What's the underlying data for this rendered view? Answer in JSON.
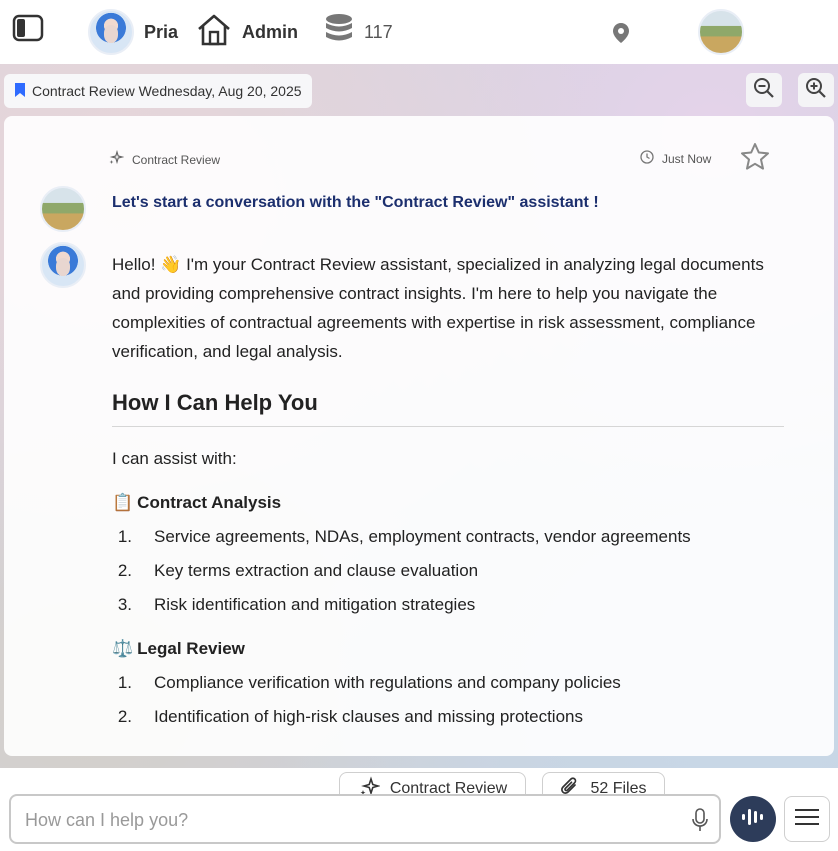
{
  "header": {
    "user_name": "Pria",
    "admin_label": "Admin",
    "credit_count": "117"
  },
  "chat": {
    "title_chip": "Contract Review Wednesday, Aug 20, 2025",
    "assistant_tag": "Contract Review",
    "time_tag": "Just Now",
    "intro": "Let's start a conversation with the \"Contract Review\" assistant !",
    "greeting": "Hello! 👋 I'm your Contract Review assistant, specialized in analyzing legal documents and providing comprehensive contract insights. I'm here to help you navigate the complexities of contractual agreements with expertise in risk assessment, compliance verification, and legal analysis.",
    "heading": "How I Can Help You",
    "assist_text": "I can assist with:",
    "sections": [
      {
        "emoji": "📋",
        "title": "Contract Analysis",
        "items": [
          "Service agreements, NDAs, employment contracts, vendor agreements",
          "Key terms extraction and clause evaluation",
          "Risk identification and mitigation strategies"
        ]
      },
      {
        "emoji": "⚖️",
        "title": "Legal Review",
        "items": [
          "Compliance verification with regulations and company policies",
          "Identification of high-risk clauses and missing protections"
        ]
      }
    ]
  },
  "composer": {
    "assistant_pill": "Contract Review",
    "files_pill": "52 Files",
    "placeholder": "How can I help you?"
  }
}
